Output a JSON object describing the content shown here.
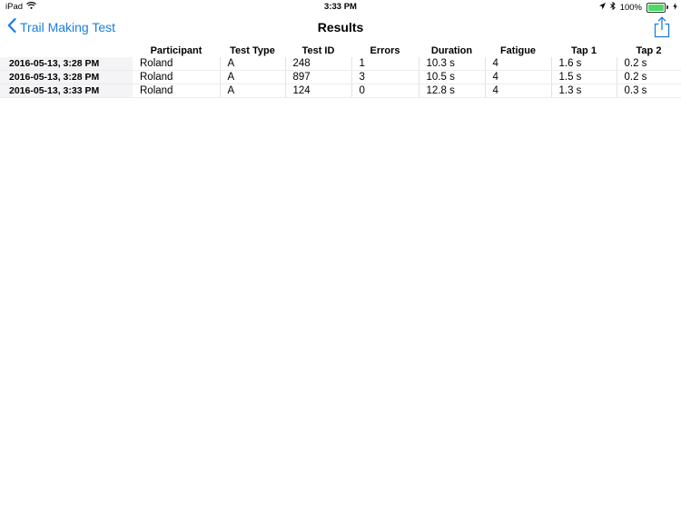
{
  "status_bar": {
    "device": "iPad",
    "time": "3:33 PM",
    "battery": "100%",
    "battery_level": 1.0,
    "icons": [
      "wifi-icon",
      "location-arrow-icon",
      "bluetooth-icon",
      "battery-icon",
      "charging-bolt-icon"
    ]
  },
  "nav": {
    "back_label": "Trail Making Test",
    "title": "Results",
    "accent_color": "#1a7de0"
  },
  "table": {
    "columns": [
      "",
      "Participant",
      "Test Type",
      "Test ID",
      "Errors",
      "Duration",
      "Fatigue",
      "Tap 1",
      "Tap 2"
    ],
    "rows": [
      [
        "2016-05-13, 3:28 PM",
        "Roland",
        "A",
        "248",
        "1",
        "10.3 s",
        "4",
        "1.6 s",
        "0.2 s"
      ],
      [
        "2016-05-13, 3:28 PM",
        "Roland",
        "A",
        "897",
        "3",
        "10.5 s",
        "4",
        "1.5 s",
        "0.2 s"
      ],
      [
        "2016-05-13, 3:33 PM",
        "Roland",
        "A",
        "124",
        "0",
        "12.8 s",
        "4",
        "1.3 s",
        "0.3 s"
      ]
    ]
  }
}
